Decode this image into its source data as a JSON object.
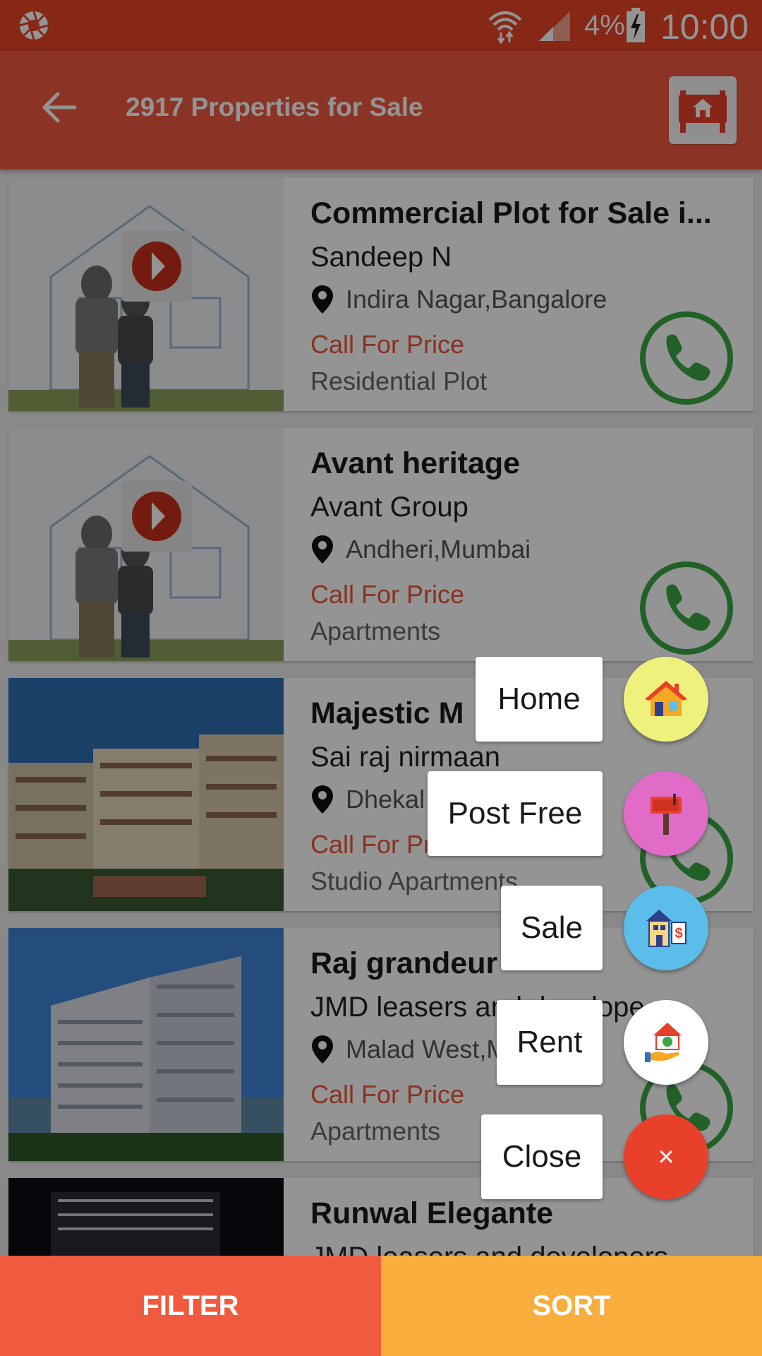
{
  "status_bar": {
    "battery": "4%",
    "time": "10:00"
  },
  "app_bar": {
    "title": "2917 Properties for Sale"
  },
  "listings": [
    {
      "name": "Commercial Plot for Sale i...",
      "builder": "Sandeep N",
      "location": "Indira Nagar,Bangalore",
      "price": "Call For Price",
      "type": "Residential Plot",
      "image": "placeholder"
    },
    {
      "name": "Avant heritage",
      "builder": "Avant Group",
      "location": "Andheri,Mumbai",
      "price": "Call For Price",
      "type": "Apartments",
      "image": "placeholder"
    },
    {
      "name": "Majestic M",
      "builder": "Sai raj nirmaan",
      "location": "Dhekal",
      "price": "Call For Pr",
      "type": "Studio Apartments",
      "image": "apartment-photo"
    },
    {
      "name": "Raj grandeur",
      "builder": "JMD leasers and develope",
      "location": "Malad West,M",
      "price": "Call For Price",
      "type": "Apartments",
      "image": "tower-photo"
    },
    {
      "name": "Runwal Elegante",
      "builder": "JMD leasers and developers",
      "location": "",
      "price": "",
      "type": "",
      "image": "night-photo"
    }
  ],
  "fab_menu": [
    {
      "label": "Home",
      "icon": "house-icon",
      "color": "#eef27c"
    },
    {
      "label": "Post Free",
      "icon": "signboard-icon",
      "color": "#e06cc8"
    },
    {
      "label": "Sale",
      "icon": "sale-building-icon",
      "color": "#5bbde9"
    },
    {
      "label": "Rent",
      "icon": "rent-hand-house-icon",
      "color": "#ffffff"
    },
    {
      "label": "Close",
      "icon": "close-icon",
      "color": "#e8402a"
    }
  ],
  "close_glyph": "×",
  "bottom_bar": {
    "filter": "FILTER",
    "sort": "SORT"
  },
  "colors": {
    "status_bar": "#e84427",
    "app_bar": "#f05b40",
    "price": "#e8563c",
    "sort": "#f9ad3c",
    "call_green": "#3aa844"
  }
}
